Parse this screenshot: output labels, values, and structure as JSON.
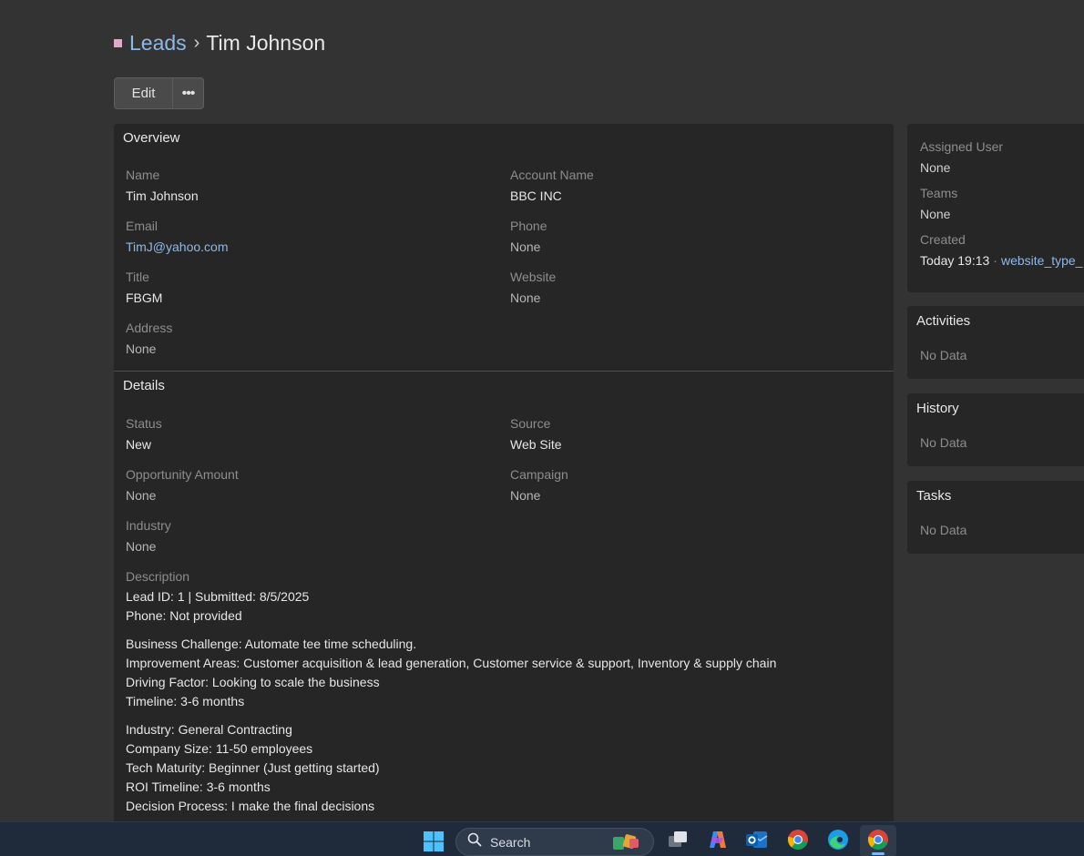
{
  "breadcrumb": {
    "parent": "Leads",
    "separator": "›",
    "current": "Tim Johnson"
  },
  "actions": {
    "edit_label": "Edit",
    "more_label": "•••"
  },
  "overview": {
    "heading": "Overview",
    "name_label": "Name",
    "name_value": "Tim Johnson",
    "account_label": "Account Name",
    "account_value": "BBC INC",
    "email_label": "Email",
    "email_value": "TimJ@yahoo.com",
    "phone_label": "Phone",
    "phone_value": "None",
    "title_label": "Title",
    "title_value": "FBGM",
    "website_label": "Website",
    "website_value": "None",
    "address_label": "Address",
    "address_value": "None"
  },
  "details": {
    "heading": "Details",
    "status_label": "Status",
    "status_value": "New",
    "source_label": "Source",
    "source_value": "Web Site",
    "opportunity_label": "Opportunity Amount",
    "opportunity_value": "None",
    "campaign_label": "Campaign",
    "campaign_value": "None",
    "industry_label": "Industry",
    "industry_value": "None",
    "description_label": "Description",
    "description": {
      "block1": [
        "Lead ID: 1 | Submitted: 8/5/2025",
        "Phone: Not provided"
      ],
      "block2": [
        "Business Challenge: Automate tee time scheduling.",
        "Improvement Areas: Customer acquisition & lead generation, Customer service & support, Inventory & supply chain",
        "Driving Factor: Looking to scale the business",
        "Timeline: 3-6 months"
      ],
      "block3": [
        "Industry: General Contracting",
        "Company Size: 11-50 employees",
        "Tech Maturity: Beginner (Just getting started)",
        "ROI Timeline: 3-6 months",
        "Decision Process: I make the final decisions"
      ]
    }
  },
  "side": {
    "assigned_label": "Assigned User",
    "assigned_value": "None",
    "teams_label": "Teams",
    "teams_value": "None",
    "created_label": "Created",
    "created_value": "Today 19:13",
    "created_dot": "·",
    "created_by": "website_type_",
    "activities_heading": "Activities",
    "activities_empty": "No Data",
    "history_heading": "History",
    "history_empty": "No Data",
    "tasks_heading": "Tasks",
    "tasks_empty": "No Data"
  },
  "taskbar": {
    "search_label": "Search",
    "icons": [
      "windows-start-icon",
      "search-icon",
      "task-view-icon",
      "copilot-icon",
      "outlook-icon",
      "chrome-icon",
      "edge-icon",
      "chrome-icon"
    ]
  },
  "colors": {
    "accent_link": "#8fb8e6",
    "entity_lead": "#e8a4cf",
    "background": "#333333",
    "panel": "#262626"
  }
}
